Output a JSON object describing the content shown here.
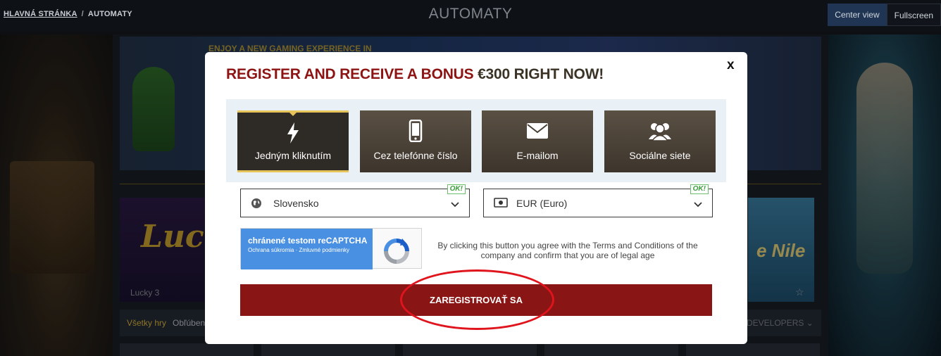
{
  "breadcrumb": {
    "home": "HLAVNÁ STRÁNKA",
    "separator": "/",
    "current": "AUTOMATY"
  },
  "page_title": "AUTOMATY",
  "view_buttons": {
    "center": "Center view",
    "fullscreen": "Fullscreen"
  },
  "background": {
    "banner_text": "ENJOY A NEW GAMING EXPERIENCE IN",
    "tile_lucky_logo": "Luck",
    "tile_lucky_name": "Lucky 3",
    "tile_nile_logo": "e Nile",
    "filter_all": "Všetky hry",
    "filter_fav": "Obľúbené",
    "filter_developers": "DEVELOPERS ⌄"
  },
  "modal": {
    "headline_red": "REGISTER AND RECEIVE A BONUS ",
    "headline_dark": "€300 RIGHT NOW!",
    "close": "x",
    "methods": [
      {
        "label": "Jedným kliknutím",
        "icon": "lightning-icon",
        "active": true
      },
      {
        "label": "Cez telefónne číslo",
        "icon": "phone-icon",
        "active": false
      },
      {
        "label": "E-mailom",
        "icon": "envelope-icon",
        "active": false
      },
      {
        "label": "Sociálne siete",
        "icon": "users-icon",
        "active": false
      }
    ],
    "country": {
      "value": "Slovensko",
      "badge": "OK!"
    },
    "currency": {
      "value": "EUR (Euro)",
      "badge": "OK!"
    },
    "captcha": {
      "title": "chránené testom reCAPTCHA",
      "links": "Ochrana súkromia · Zmluvné podmienky"
    },
    "terms": "By clicking this button you agree with the Terms and Conditions of the company and confirm that you are of legal age",
    "submit": "ZAREGISTROVAŤ SA"
  },
  "colors": {
    "accent_red": "#8a1515",
    "gold": "#e6c45a",
    "annotation_ring": "#e0141c"
  }
}
